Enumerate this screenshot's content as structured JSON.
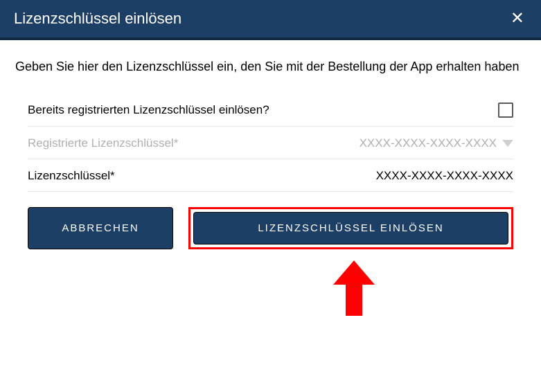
{
  "header": {
    "title": "Lizenzschlüssel einlösen"
  },
  "instruction": "Geben Sie hier den Lizenzschlüssel ein, den Sie mit der Bestellung der App erhalten haben",
  "form": {
    "already_registered_label": "Bereits registrierten Lizenzschlüssel einlösen?",
    "registered_label": "Registrierte Lizenzschlüssel*",
    "registered_placeholder": "XXXX-XXXX-XXXX-XXXX",
    "license_label": "Lizenzschlüssel*",
    "license_value": "XXXX-XXXX-XXXX-XXXX"
  },
  "buttons": {
    "cancel": "ABBRECHEN",
    "submit": "LIZENZSCHLÜSSEL EINLÖSEN"
  },
  "colors": {
    "primary": "#1d3f65",
    "highlight": "#ff0000"
  }
}
